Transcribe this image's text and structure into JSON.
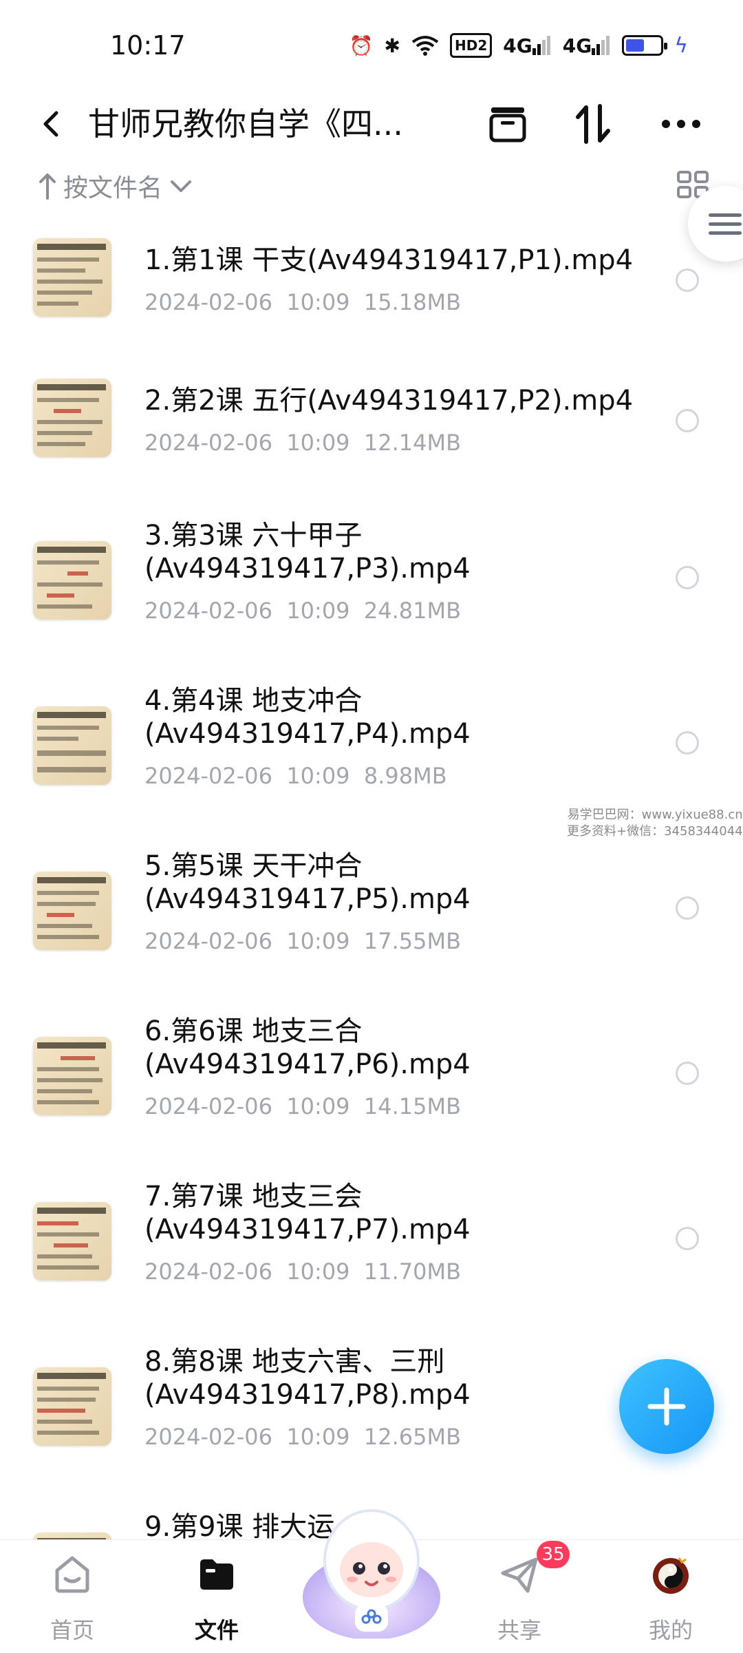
{
  "status_bar": {
    "time": "10:17",
    "icons": [
      "alarm-icon",
      "bluetooth-icon",
      "wifi-icon",
      "hd-icon",
      "signal-4g-icon",
      "signal-4g-icon",
      "battery-icon",
      "charging-icon"
    ],
    "hd_label": "HD2",
    "net_label": "4G",
    "battery_level": 0.55
  },
  "header": {
    "title": "甘师兄教你自学《四...",
    "back_icon": "chevron-left-icon",
    "actions": [
      "archive-icon",
      "sort-icon",
      "more-icon"
    ]
  },
  "sort": {
    "label": "按文件名"
  },
  "files": [
    {
      "name": "1.第1课 干支(Av494319417,P1).mp4",
      "date": "2024-02-06",
      "time": "10:09",
      "size": "15.18MB"
    },
    {
      "name": "2.第2课 五行(Av494319417,P2).mp4",
      "date": "2024-02-06",
      "time": "10:09",
      "size": "12.14MB"
    },
    {
      "name": "3.第3课 六十甲子(Av494319417,P3).mp4",
      "date": "2024-02-06",
      "time": "10:09",
      "size": "24.81MB"
    },
    {
      "name": "4.第4课 地支冲合(Av494319417,P4).mp4",
      "date": "2024-02-06",
      "time": "10:09",
      "size": "8.98MB"
    },
    {
      "name": "5.第5课 天干冲合(Av494319417,P5).mp4",
      "date": "2024-02-06",
      "time": "10:09",
      "size": "17.55MB"
    },
    {
      "name": "6.第6课 地支三合(Av494319417,P6).mp4",
      "date": "2024-02-06",
      "time": "10:09",
      "size": "14.15MB"
    },
    {
      "name": "7.第7课 地支三会(Av494319417,P7).mp4",
      "date": "2024-02-06",
      "time": "10:09",
      "size": "11.70MB"
    },
    {
      "name": "8.第8课 地支六害、三刑(Av494319417,P8).mp4",
      "date": "2024-02-06",
      "time": "10:09",
      "size": "12.65MB"
    },
    {
      "name": "9.第9课 排大运",
      "date": "",
      "time": "",
      "size": ""
    }
  ],
  "watermark": {
    "line1": "易学巴巴网：www.yixue88.cn",
    "line2": "更多资料+微信：3458344044"
  },
  "nav": {
    "home": "首页",
    "files": "文件",
    "share": "共享",
    "mine": "我的",
    "share_badge": "35"
  },
  "colors": {
    "accent": "#1596f5",
    "badge": "#ff3b5c",
    "battery": "#3f53e8"
  }
}
